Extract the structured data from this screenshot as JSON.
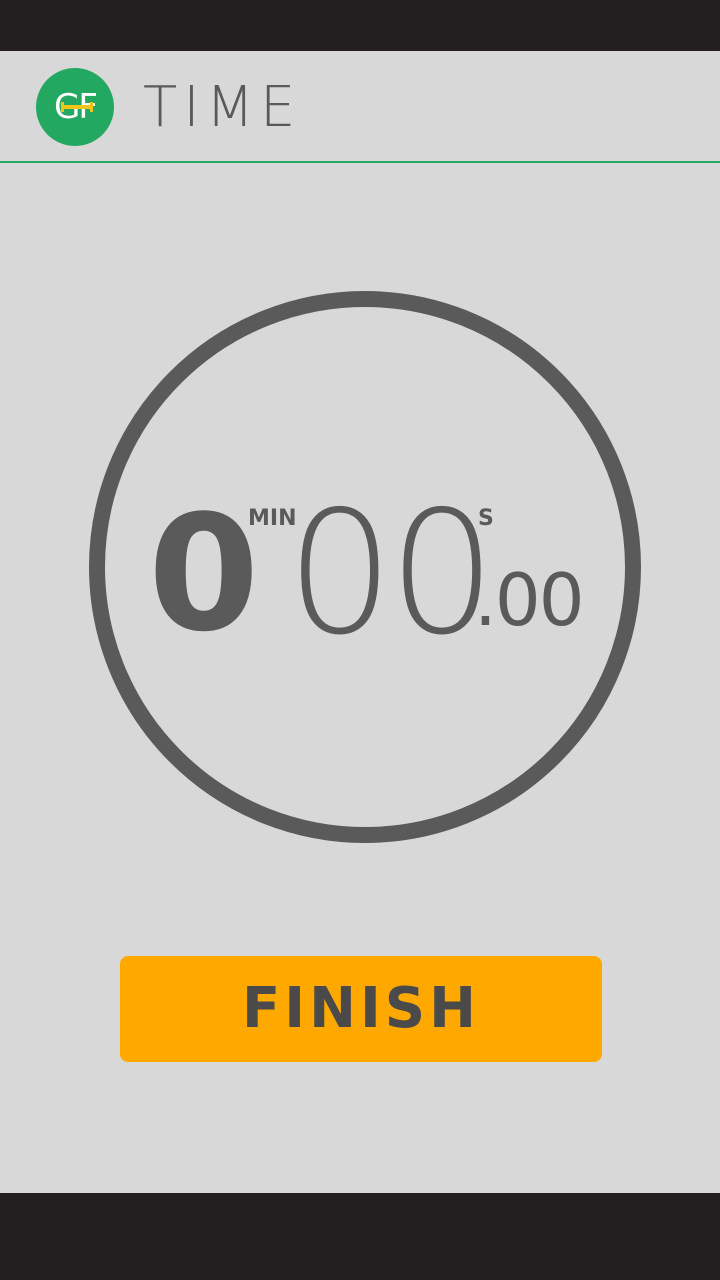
{
  "header": {
    "logo_text": "GF",
    "title": "TIME"
  },
  "timer": {
    "minutes": "0",
    "minutes_unit": "MIN",
    "seconds": "00",
    "seconds_unit": "S",
    "hundredths": ".00"
  },
  "actions": {
    "finish_label": "FINISH"
  },
  "colors": {
    "accent_green": "#23a862",
    "button_orange": "#ffa800",
    "text_gray": "#5a5a5a",
    "background": "#d8d8d8",
    "system_bar": "#231f20"
  }
}
